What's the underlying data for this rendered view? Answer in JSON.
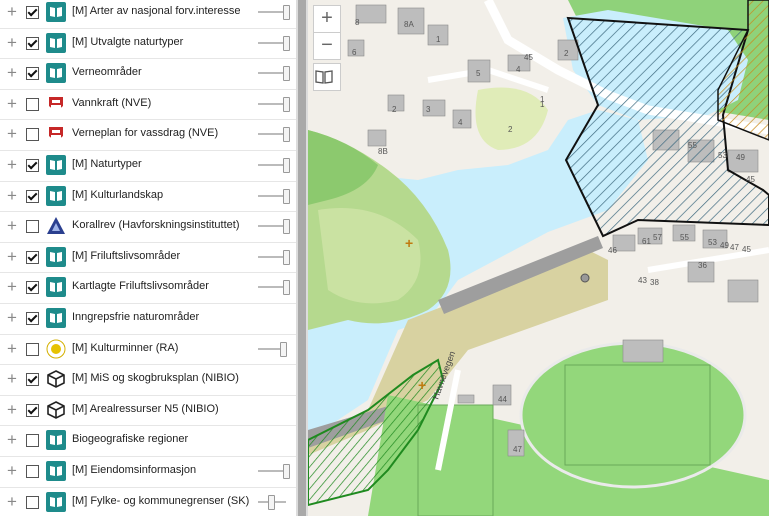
{
  "layers": [
    {
      "name": "[M] Arter av nasjonal forv.interesse",
      "checked": true,
      "icon": "map-book-icon",
      "slider": 0.95
    },
    {
      "name": "[M] Utvalgte naturtyper",
      "checked": true,
      "icon": "map-book-icon",
      "slider": 0.95
    },
    {
      "name": "Verneområder",
      "checked": true,
      "icon": "map-book-icon",
      "slider": 0.95
    },
    {
      "name": "Vannkraft (NVE)",
      "checked": false,
      "icon": "nve-icon",
      "slider": 0.95
    },
    {
      "name": "Verneplan for vassdrag (NVE)",
      "checked": false,
      "icon": "nve-icon",
      "slider": 0.95
    },
    {
      "name": "[M] Naturtyper",
      "checked": true,
      "icon": "map-book-icon",
      "slider": 0.95
    },
    {
      "name": "[M] Kulturlandskap",
      "checked": true,
      "icon": "map-book-icon",
      "slider": 0.95
    },
    {
      "name": "Korallrev (Havforskningsinstituttet)",
      "checked": false,
      "icon": "havforskning-icon",
      "slider": 0.95
    },
    {
      "name": "[M] Friluftslivsområder",
      "checked": true,
      "icon": "map-book-icon",
      "slider": 0.95
    },
    {
      "name": "Kartlagte Friluftslivsområder",
      "checked": true,
      "icon": "map-book-icon",
      "slider": 0.95
    },
    {
      "name": "Inngrepsfrie naturområder",
      "checked": true,
      "icon": "map-book-icon",
      "slider": null
    },
    {
      "name": "[M] Kulturminner (RA)",
      "checked": false,
      "icon": "riksantikvaren-icon",
      "slider": 0.85
    },
    {
      "name": "[M] MiS og skogbruksplan (NIBIO)",
      "checked": true,
      "icon": "nibio-icon",
      "slider": null
    },
    {
      "name": "[M] Arealressurser N5 (NIBIO)",
      "checked": true,
      "icon": "nibio-icon",
      "slider": null
    },
    {
      "name": "Biogeografiske regioner",
      "checked": false,
      "icon": "map-book-icon",
      "slider": null
    },
    {
      "name": "[M] Eiendomsinformasjon",
      "checked": false,
      "icon": "map-book-icon",
      "slider": 0.95
    },
    {
      "name": "[M] Fylke- og kommunegrenser (SK)",
      "checked": false,
      "icon": "map-book-icon",
      "slider": 0.4
    }
  ],
  "map_controls": {
    "zoom_in": "+",
    "zoom_out": "−"
  },
  "map_labels": {
    "road": "Havnevegen",
    "house_numbers": [
      "8",
      "8A",
      "1",
      "6",
      "5",
      "4",
      "2",
      "2",
      "4",
      "3",
      "1",
      "8B",
      "2",
      "55",
      "53",
      "49",
      "45",
      "46",
      "61",
      "57",
      "55",
      "53",
      "49",
      "47",
      "45",
      "43",
      "38",
      "36",
      "44",
      "47",
      "45",
      "1"
    ]
  },
  "colors": {
    "water": "#c9eefc",
    "grass": "#93d77b",
    "park": "#cfe3a8",
    "sand": "#d8d2a1",
    "building": "#bdbdbd",
    "hatch_blue": "#3e6a80",
    "hatch_green": "#1f8a1f",
    "hatch_orange": "#c98a1a",
    "outline": "#111111"
  }
}
